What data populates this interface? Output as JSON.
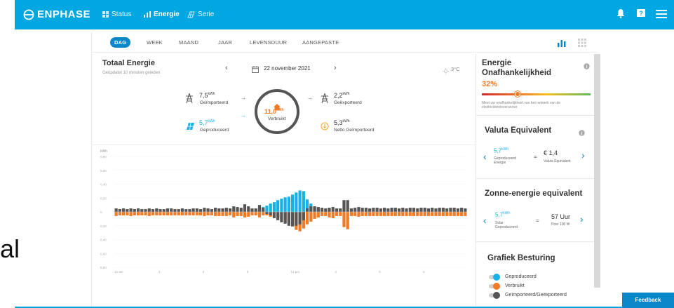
{
  "brand": {
    "name": "ENPHASE"
  },
  "nav": [
    {
      "label": "Status",
      "icon": "grid-icon"
    },
    {
      "label": "Energie",
      "icon": "bar-chart-icon"
    },
    {
      "label": "Serie",
      "icon": "solar-panel-icon"
    }
  ],
  "stray_text": "al",
  "periods": [
    "DAG",
    "WEEK",
    "MAAND",
    "JAAR",
    "LEVENSDUUR",
    "AANGEPASTE"
  ],
  "active_period": "DAG",
  "energy": {
    "title": "Totaal Energie",
    "updated": "Geüpdatet 10 minuten geleden",
    "date": "22 november 2021",
    "weather": "3°C",
    "imported_value": "7,5",
    "imported_unit": "kWh",
    "imported_label": "Geïmporteerd",
    "produced_value": "5,7",
    "produced_unit": "kWh",
    "produced_label": "Geproduceerd",
    "consumed_value": "11,0",
    "consumed_unit": "kWh",
    "consumed_label": "Verbruikt",
    "exported_value": "2,2",
    "exported_unit": "kWh",
    "exported_label": "Geëxporteerd",
    "net_value": "5,3",
    "net_unit": "kWh",
    "net_label": "Netto Geïmporteerd"
  },
  "chart_data": {
    "type": "bar",
    "ylabel": "kWh",
    "ytick_labels": [
      "0,80",
      "0,60",
      "0,40",
      "0,20",
      "0",
      "0,20",
      "0,40",
      "0,60",
      "0,80"
    ],
    "ylim": [
      -0.8,
      0.8
    ],
    "xtick_labels": [
      "12 am",
      "3",
      "6",
      "9",
      "12 pm",
      "3",
      "6",
      "9"
    ],
    "n_intervals": 96,
    "series": [
      {
        "name": "Geproduceerd",
        "color": "#1ab0e5",
        "values": [
          0,
          0,
          0,
          0,
          0,
          0,
          0,
          0,
          0,
          0,
          0,
          0,
          0,
          0,
          0,
          0,
          0,
          0,
          0,
          0,
          0,
          0,
          0,
          0,
          0,
          0,
          0,
          0,
          0,
          0,
          0,
          0,
          0,
          0,
          0,
          0,
          0,
          0.02,
          0.03,
          0.05,
          0.07,
          0.09,
          0.12,
          0.14,
          0.17,
          0.19,
          0.21,
          0.22,
          0.25,
          0.28,
          0.31,
          0.3,
          0.18,
          0.12,
          0.08,
          0.05,
          0.03,
          0.01,
          0,
          0,
          0,
          0,
          0,
          0,
          0,
          0,
          0,
          0,
          0,
          0,
          0,
          0,
          0,
          0,
          0,
          0,
          0,
          0,
          0,
          0,
          0,
          0,
          0,
          0,
          0,
          0,
          0,
          0,
          0,
          0,
          0,
          0,
          0,
          0,
          0,
          0
        ]
      },
      {
        "name": "Verbruikt",
        "color": "#f07a25",
        "values": [
          -0.06,
          -0.05,
          -0.05,
          -0.05,
          -0.06,
          -0.05,
          -0.05,
          -0.05,
          -0.05,
          -0.06,
          -0.05,
          -0.05,
          -0.05,
          -0.05,
          -0.05,
          -0.05,
          -0.05,
          -0.05,
          -0.05,
          -0.05,
          -0.05,
          -0.05,
          -0.05,
          -0.05,
          -0.06,
          -0.05,
          -0.05,
          -0.06,
          -0.06,
          -0.06,
          -0.06,
          -0.05,
          -0.08,
          -0.06,
          -0.06,
          -0.08,
          -0.07,
          -0.05,
          -0.05,
          -0.08,
          -0.05,
          -0.05,
          -0.07,
          -0.08,
          -0.09,
          -0.1,
          -0.13,
          -0.15,
          -0.2,
          -0.26,
          -0.28,
          -0.24,
          -0.18,
          -0.14,
          -0.1,
          -0.08,
          -0.06,
          -0.06,
          -0.08,
          -0.09,
          -0.06,
          -0.06,
          -0.22,
          -0.25,
          -0.06,
          -0.06,
          -0.07,
          -0.06,
          -0.06,
          -0.06,
          -0.06,
          -0.06,
          -0.06,
          -0.06,
          -0.06,
          -0.06,
          -0.06,
          -0.06,
          -0.06,
          -0.06,
          -0.06,
          -0.06,
          -0.06,
          -0.06,
          -0.06,
          -0.06,
          -0.06,
          -0.06,
          -0.06,
          -0.06,
          -0.06,
          -0.06,
          -0.06,
          -0.06,
          -0.06,
          -0.06
        ]
      },
      {
        "name": "Geïmporteerd/Geëxporteerd",
        "color": "#555555",
        "values": [
          0.05,
          0.04,
          0.05,
          0.04,
          0.05,
          0.04,
          0.05,
          0.04,
          0.04,
          0.05,
          0.04,
          0.05,
          0.04,
          0.04,
          0.05,
          0.05,
          0.04,
          0.04,
          0.05,
          0.04,
          0.04,
          0.05,
          0.05,
          0.04,
          0.06,
          0.05,
          0.04,
          0.06,
          0.05,
          0.05,
          0.06,
          0.05,
          0.08,
          0.07,
          0.06,
          0.11,
          0.08,
          0.05,
          0.05,
          0.1,
          0.06,
          -0.03,
          -0.05,
          -0.09,
          -0.12,
          -0.15,
          -0.17,
          -0.2,
          -0.21,
          -0.2,
          -0.18,
          -0.12,
          0.05,
          0.08,
          0.08,
          0.07,
          0.06,
          0.05,
          0.06,
          0.07,
          0.05,
          0.05,
          0.17,
          0.17,
          0.05,
          0.06,
          0.07,
          0.06,
          0.06,
          0.05,
          0.06,
          0.06,
          0.05,
          0.06,
          0.05,
          0.06,
          0.06,
          0.05,
          0.06,
          0.05,
          0.06,
          0.06,
          0.05,
          0.06,
          0.06,
          0.05,
          0.06,
          0.05,
          0.06,
          0.06,
          0.05,
          0.06,
          0.06,
          0.05,
          0.06,
          0.05
        ]
      }
    ]
  },
  "independence": {
    "title": "Energie Onafhankelijkheid",
    "percent": "32%",
    "percent_value": 0.32,
    "desc": "Meet uw onafhankelijkheid van het netwerk van de elektriciteitsleverancier"
  },
  "currency": {
    "title": "Valuta Equivalent",
    "value": "5,7",
    "unit": "kWh",
    "label": "Geproduceerd Energie",
    "eq": "=",
    "amount": "€ 1,4",
    "amount_label": "Valuta Equivalent"
  },
  "solar": {
    "title": "Zonne-energie equivalent",
    "value": "5,7",
    "unit": "kWh",
    "label": "Solar Geproduceerd",
    "eq": "=",
    "amount": "57 Uur",
    "amount_label": "Peer 100 W"
  },
  "graph_control": {
    "title": "Grafiek Besturing",
    "items": [
      {
        "label": "Geproduceerd",
        "color": "#1ab0e5"
      },
      {
        "label": "Verbruikt",
        "color": "#f07a25"
      },
      {
        "label": "Geïmporteerd/Geëxporteerd",
        "color": "#555555"
      }
    ]
  },
  "feedback": "Feedback"
}
